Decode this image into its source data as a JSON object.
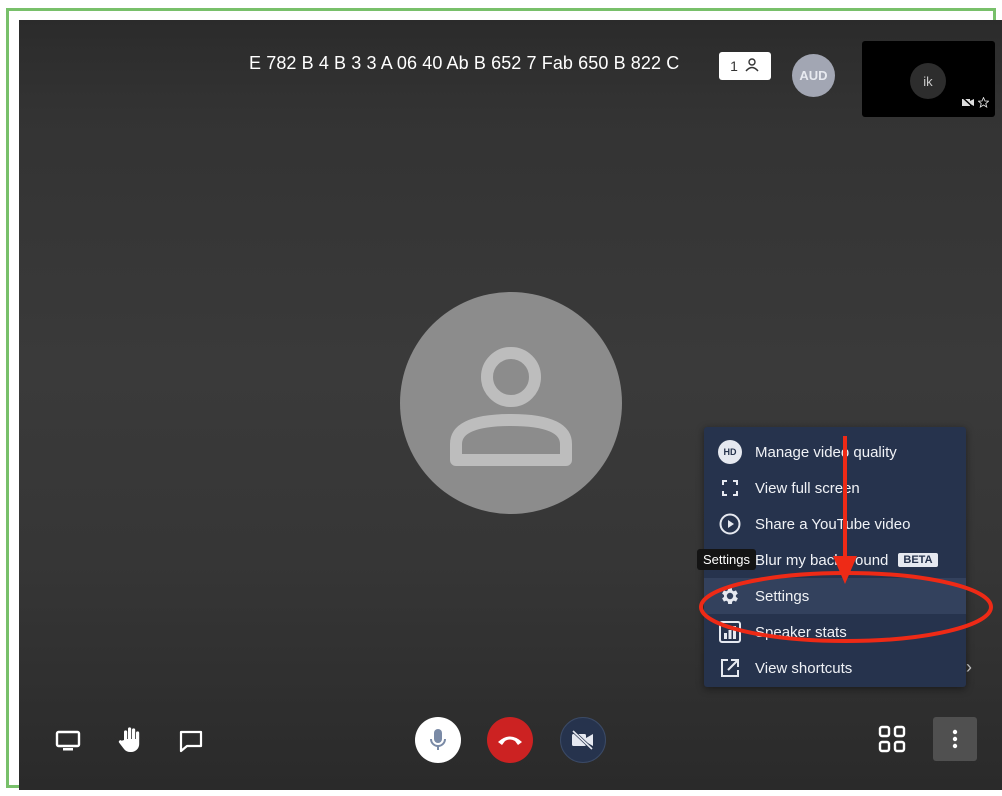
{
  "header": {
    "conference_name": "E 782 B 4 B 3 3 A 06 40 Ab B 652 7 Fab 650 B 822 C",
    "participant_count": "1",
    "remote_avatar_initials": "AUD",
    "local_thumbnail_initials": "ik"
  },
  "overflow_menu": {
    "items": [
      {
        "label": "Manage video quality",
        "icon": "hd-icon"
      },
      {
        "label": "View full screen",
        "icon": "fullscreen-icon"
      },
      {
        "label": "Share a YouTube video",
        "icon": "play-circle-icon"
      },
      {
        "label": "Blur my background",
        "icon": "blur-icon",
        "badge": "BETA"
      },
      {
        "label": "Settings",
        "icon": "gear-icon"
      },
      {
        "label": "Speaker stats",
        "icon": "bar-chart-icon"
      },
      {
        "label": "View shortcuts",
        "icon": "external-link-icon"
      }
    ],
    "hd_icon_text": "HD"
  },
  "tooltip": {
    "text": "Settings"
  },
  "colors": {
    "stage_background": "#333333",
    "menu_background": "#26334d",
    "hangup_red": "#cc2222",
    "annotation_red": "#ee2a16",
    "frame_green": "#78c06a"
  }
}
